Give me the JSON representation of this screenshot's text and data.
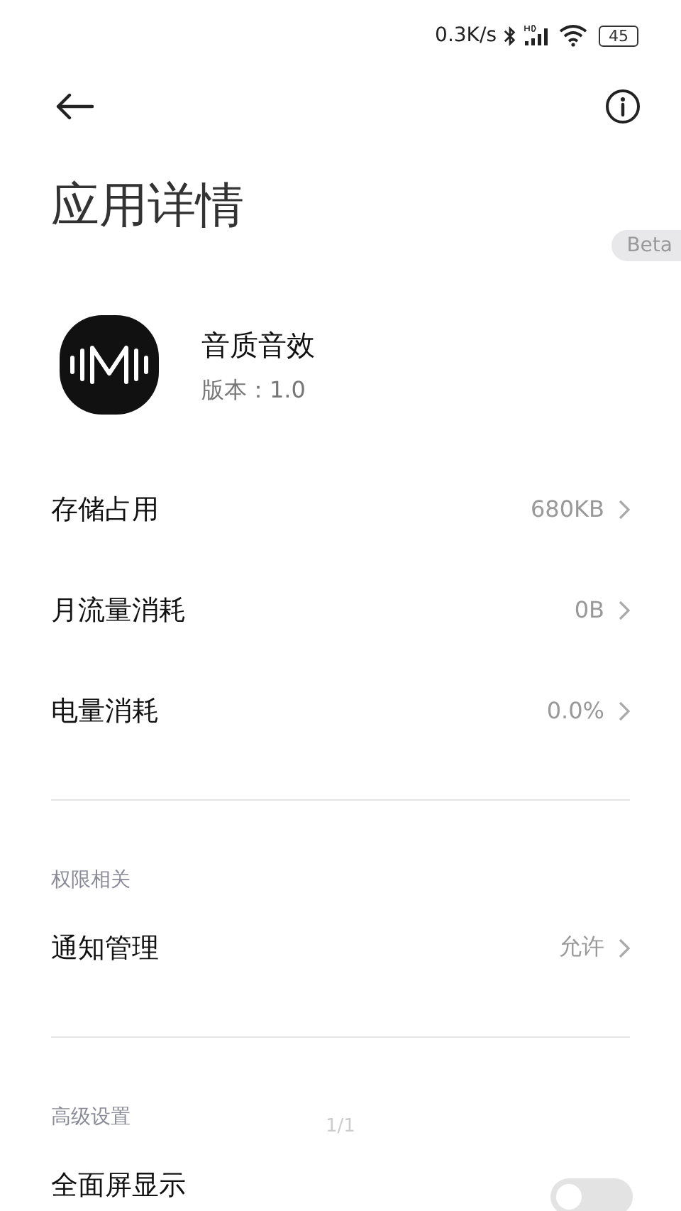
{
  "status_bar": {
    "network_speed": "0.3K/s",
    "battery": "45"
  },
  "header": {
    "title": "应用详情"
  },
  "badge": "Beta",
  "app": {
    "name": "音质音效",
    "version": "版本：1.0"
  },
  "sections": [
    {
      "items": [
        {
          "kind": "link",
          "label": "存储占用",
          "value": "680KB"
        },
        {
          "kind": "link",
          "label": "月流量消耗",
          "value": "0B"
        },
        {
          "kind": "link",
          "label": "电量消耗",
          "value": "0.0%"
        }
      ]
    },
    {
      "label": "权限相关",
      "items": [
        {
          "kind": "link",
          "label": "通知管理",
          "value": "允许"
        }
      ]
    },
    {
      "label": "高级设置",
      "items": [
        {
          "kind": "toggle",
          "label": "全面屏显示",
          "on": false
        }
      ]
    }
  ],
  "page_indicator": "1/1"
}
